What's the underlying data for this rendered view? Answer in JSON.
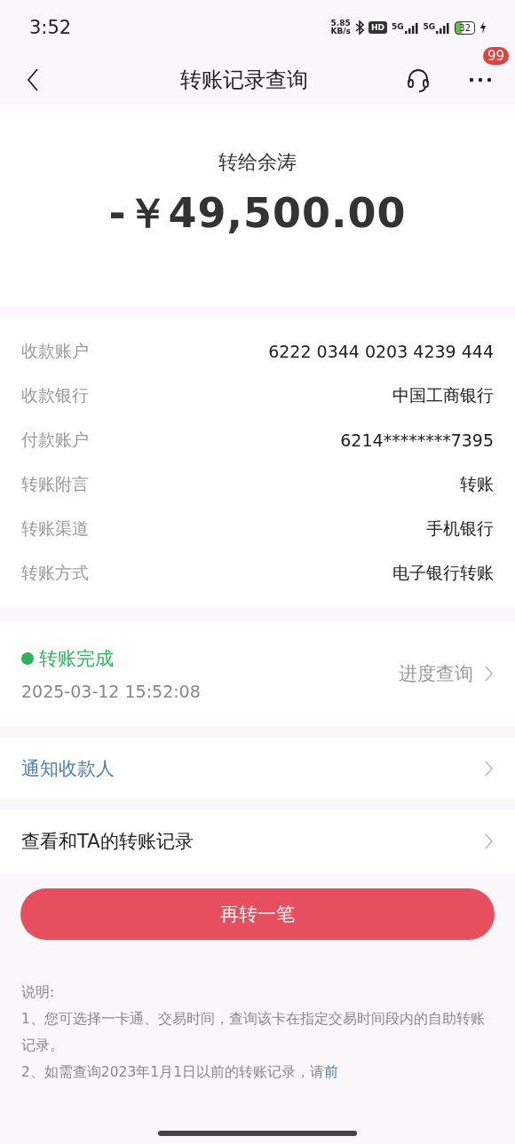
{
  "status_bar": {
    "time": "3:52",
    "speed_value": "5.85",
    "speed_unit": "KB/s",
    "hd": "HD",
    "signals": [
      "5G",
      "5G"
    ],
    "battery": "32"
  },
  "nav": {
    "title": "转账记录查询",
    "badge": "99"
  },
  "summary": {
    "recipient": "转给余涛",
    "amount": "-￥49,500.00"
  },
  "details": [
    {
      "label": "收款账户",
      "value": "6222 0344 0203 4239 444"
    },
    {
      "label": "收款银行",
      "value": "中国工商银行"
    },
    {
      "label": "付款账户",
      "value": "6214********7395"
    },
    {
      "label": "转账附言",
      "value": "转账"
    },
    {
      "label": "转账渠道",
      "value": "手机银行"
    },
    {
      "label": "转账方式",
      "value": "电子银行转账"
    }
  ],
  "status": {
    "text": "转账完成",
    "color": "#2db35a",
    "time": "2025-03-12 15:52:08",
    "action": "进度查询"
  },
  "rows": [
    {
      "label": "通知收款人",
      "kind": "link"
    },
    {
      "label": "查看和TA的转账记录",
      "kind": "plain"
    }
  ],
  "button": "再转一笔",
  "notes": {
    "title": "说明:",
    "lines": [
      {
        "text": "1、您可选择一卡通、交易时间，查询该卡在指定交易时间段内的自助转账记录。"
      },
      {
        "text": "2、如需查询2023年1月1日以前的转账记录，请",
        "link": "前"
      }
    ]
  }
}
